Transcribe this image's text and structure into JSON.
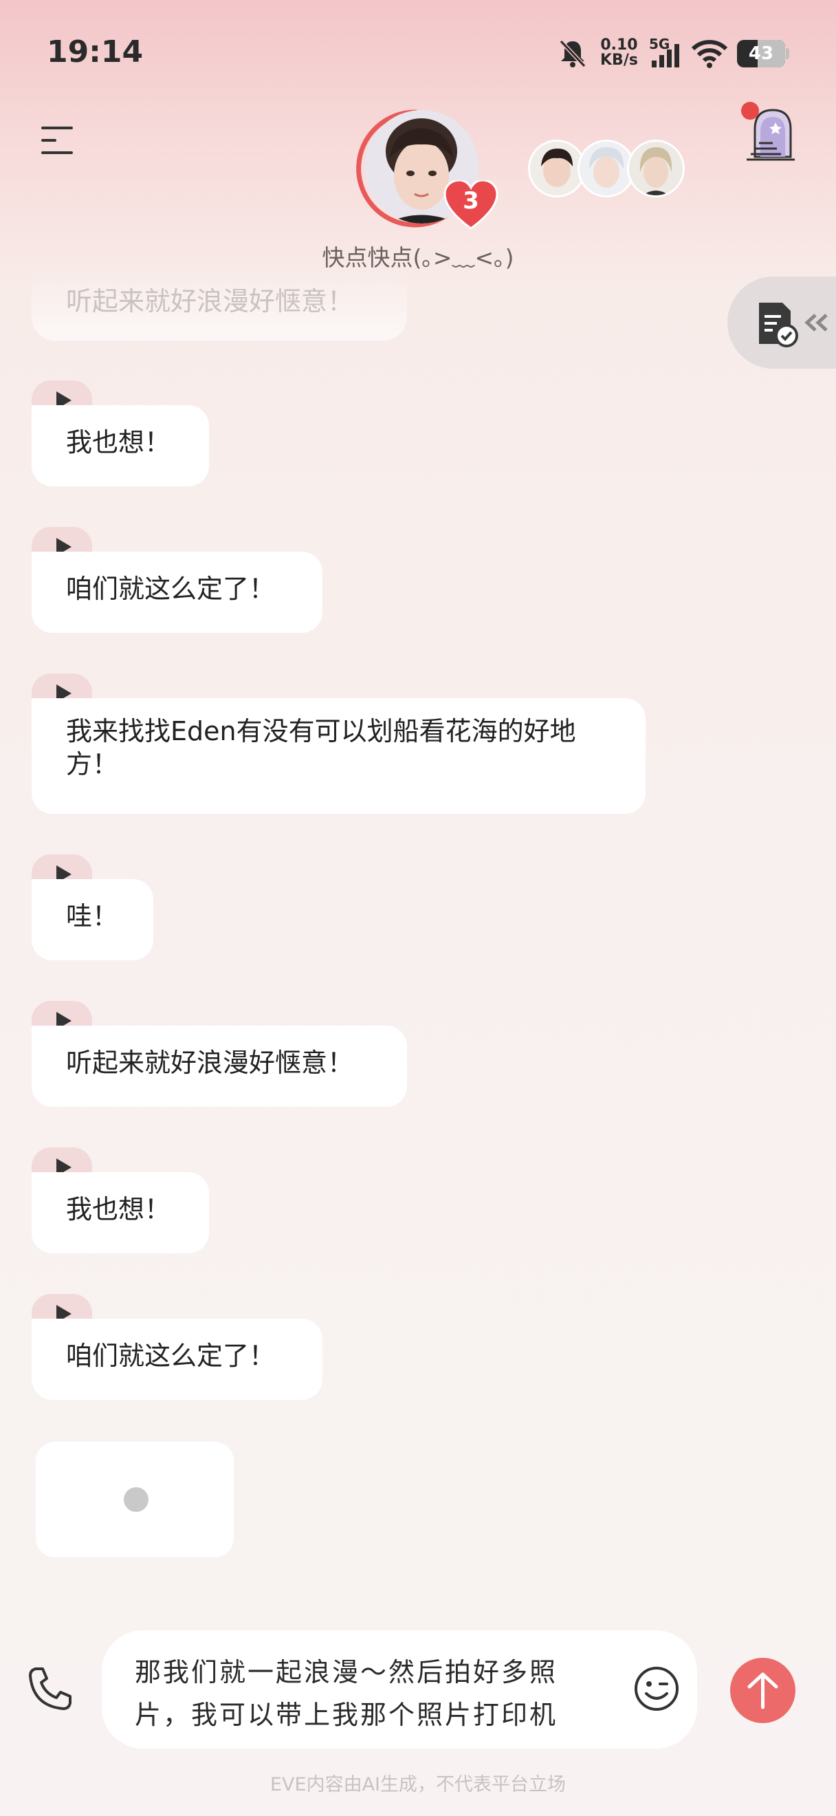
{
  "status_bar": {
    "time": "19:14",
    "net_speed_value": "0.10",
    "net_speed_unit": "KB/s",
    "network_type": "5G",
    "battery": "43"
  },
  "header": {
    "affection_count": "3",
    "character_status": "快点快点(｡>﹏<｡)"
  },
  "messages": [
    {
      "text": "我也想！"
    },
    {
      "text": "咱们就这么定了！"
    },
    {
      "text": "我来找找Eden有没有可以划船看花海的好地\n方！"
    },
    {
      "text": "哇！"
    },
    {
      "text": "听起来就好浪漫好惬意！"
    },
    {
      "text": "我也想！"
    },
    {
      "text": "咱们就这么定了！"
    }
  ],
  "faded_message": "听起来就好浪漫好惬意！",
  "composer": {
    "draft_text": "那我们就一起浪漫～然后拍好多照片，我可以带上我那个照片打印机"
  },
  "footer": {
    "disclaimer": "EVE内容由AI生成，不代表平台立场"
  },
  "colors": {
    "accent": "#ec6a6a",
    "bubble": "#ffffff",
    "play_tab": "#f2d9da"
  }
}
